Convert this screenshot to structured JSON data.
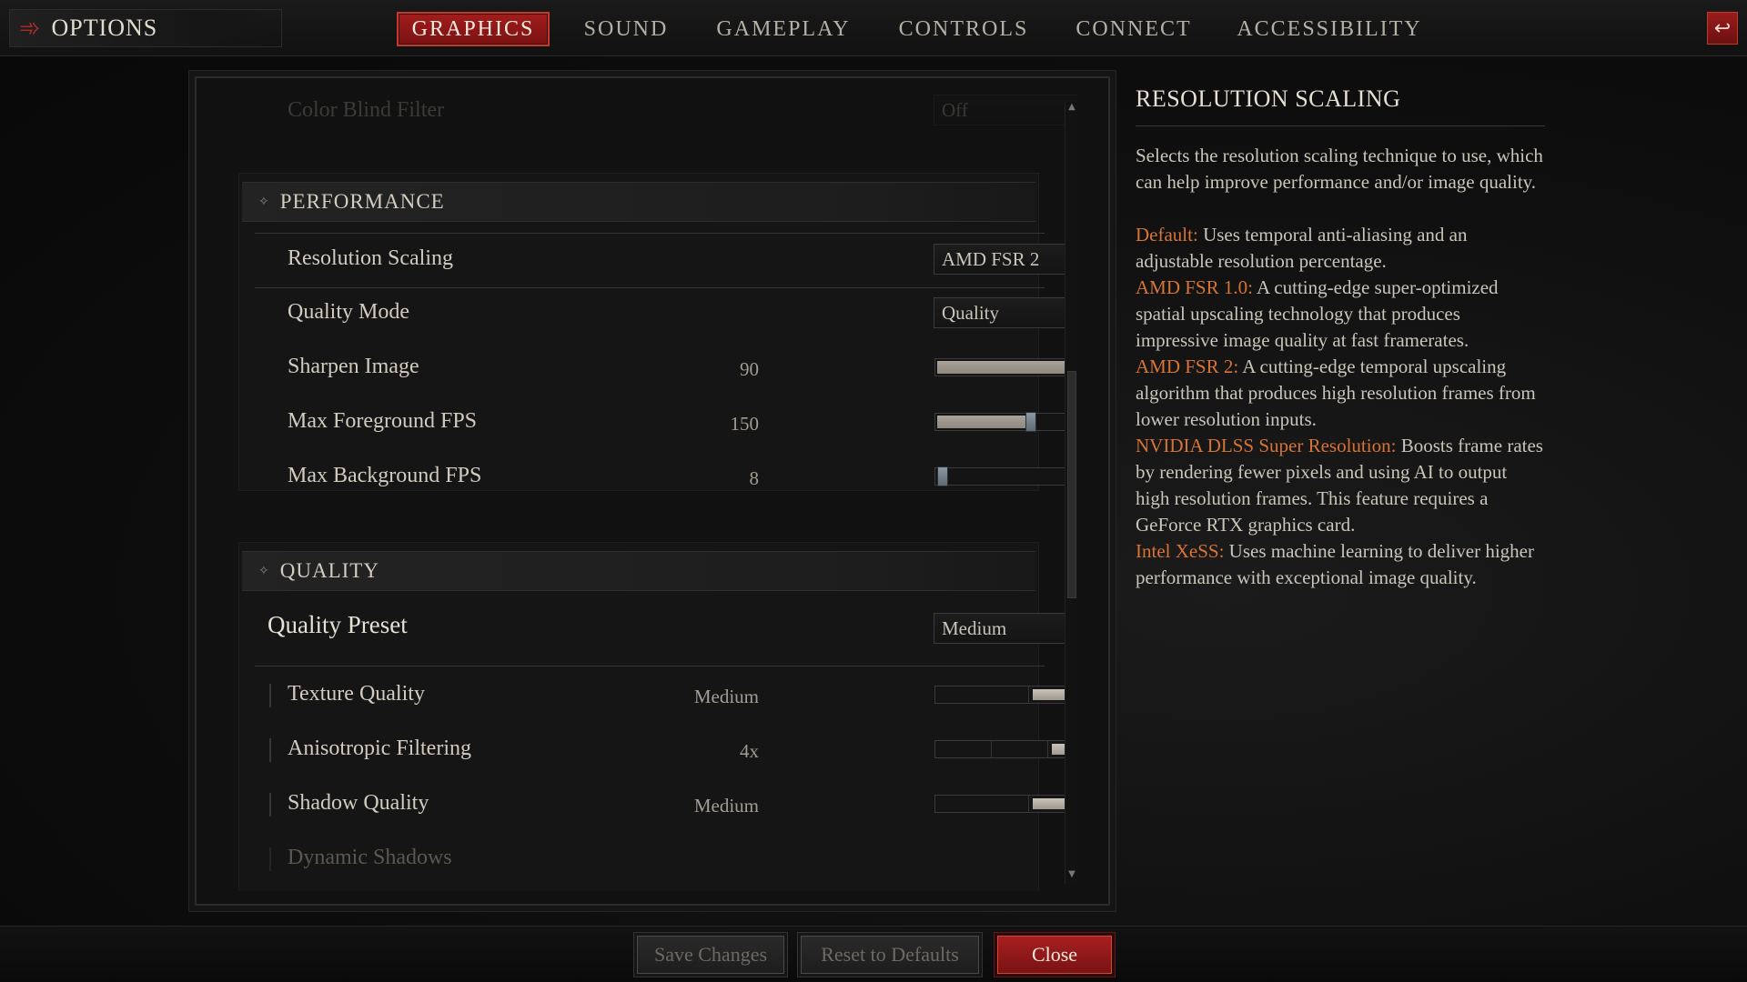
{
  "header": {
    "title": "OPTIONS",
    "tabs": [
      {
        "label": "GRAPHICS",
        "active": true
      },
      {
        "label": "SOUND",
        "active": false
      },
      {
        "label": "GAMEPLAY",
        "active": false
      },
      {
        "label": "CONTROLS",
        "active": false
      },
      {
        "label": "CONNECT",
        "active": false
      },
      {
        "label": "ACCESSIBILITY",
        "active": false
      }
    ]
  },
  "settings": {
    "faded_row": {
      "label": "Color Blind Filter",
      "value": "Off"
    },
    "performance": {
      "title": "PERFORMANCE",
      "resolution_scaling": {
        "label": "Resolution Scaling",
        "value": "AMD FSR 2"
      },
      "quality_mode": {
        "label": "Quality Mode",
        "value": "Quality"
      },
      "sharpen_image": {
        "label": "Sharpen Image",
        "value": "90",
        "level": 0.9
      },
      "max_fg_fps": {
        "label": "Max Foreground FPS",
        "value": "150",
        "level": 0.34
      },
      "max_bg_fps": {
        "label": "Max Background FPS",
        "value": "8",
        "level": 0.02
      }
    },
    "quality": {
      "title": "QUALITY",
      "preset": {
        "label": "Quality Preset",
        "value": "Medium"
      },
      "texture": {
        "label": "Texture Quality",
        "value": "Medium",
        "step": 2,
        "steps": 3
      },
      "aniso": {
        "label": "Anisotropic Filtering",
        "value": "4x",
        "step": 3,
        "steps": 5
      },
      "shadow": {
        "label": "Shadow Quality",
        "value": "Medium",
        "step": 2,
        "steps": 3
      },
      "dynamic_shadows": {
        "label": "Dynamic Shadows",
        "checked": false
      }
    }
  },
  "info": {
    "title": "RESOLUTION SCALING",
    "intro": "Selects the resolution scaling technique to use, which can help improve performance and/or image quality.",
    "items": [
      {
        "term": "Default:",
        "text": " Uses temporal anti-aliasing and an adjustable resolution percentage."
      },
      {
        "term": "AMD FSR 1.0:",
        "text": " A cutting-edge super-optimized spatial upscaling technology that produces impressive image quality at fast framerates."
      },
      {
        "term": "AMD FSR 2:",
        "text": " A cutting-edge temporal upscaling algorithm that produces high resolution frames from lower resolution inputs."
      },
      {
        "term": "NVIDIA DLSS Super Resolution:",
        "text": " Boosts frame rates by rendering fewer pixels and using AI to output high resolution frames. This feature requires a GeForce RTX graphics card."
      },
      {
        "term": "Intel XeSS:",
        "text": " Uses machine learning to deliver higher performance with exceptional image quality."
      }
    ]
  },
  "footer": {
    "save": "Save Changes",
    "reset": "Reset to Defaults",
    "close": "Close"
  },
  "colors": {
    "accent": "#a21d1d",
    "term": "#d87336"
  }
}
